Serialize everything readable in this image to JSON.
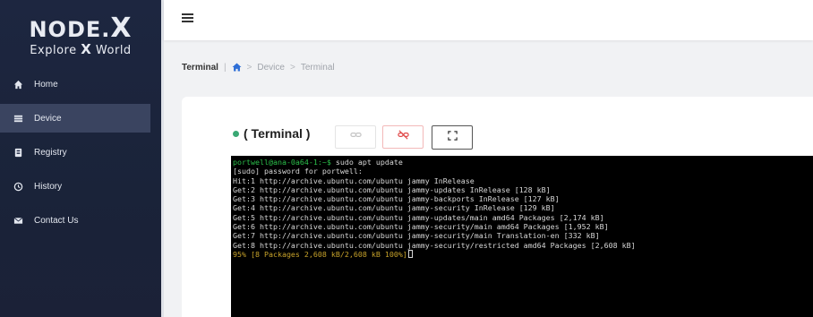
{
  "brand": {
    "title_prefix": "NODE.",
    "title_x": "X",
    "subtitle_a": "Explore ",
    "subtitle_x": "X",
    "subtitle_b": " World"
  },
  "nav": {
    "items": [
      {
        "label": "Home",
        "icon": "home-icon"
      },
      {
        "label": "Device",
        "icon": "device-icon",
        "active": true
      },
      {
        "label": "Registry",
        "icon": "registry-icon"
      },
      {
        "label": "History",
        "icon": "history-icon"
      },
      {
        "label": "Contact Us",
        "icon": "mail-icon"
      }
    ]
  },
  "breadcrumb": {
    "current": "Terminal",
    "divider": "|",
    "sep1": ">",
    "item1": "Device",
    "sep2": ">",
    "item2": "Terminal"
  },
  "terminal_panel": {
    "title": "( Terminal )",
    "status_color": "#3aa874",
    "buttons": [
      {
        "name": "connect",
        "icon": "link-icon"
      },
      {
        "name": "disconnect",
        "icon": "unlink-icon",
        "color": "#e04848"
      },
      {
        "name": "fullscreen",
        "icon": "fullscreen-icon"
      }
    ]
  },
  "terminal": {
    "prompt": "portwell@ana-0a64-1:~$",
    "command": " sudo apt update",
    "lines": [
      "[sudo] password for portwell:",
      "Hit:1 http://archive.ubuntu.com/ubuntu jammy InRelease",
      "Get:2 http://archive.ubuntu.com/ubuntu jammy-updates InRelease [128 kB]",
      "Get:3 http://archive.ubuntu.com/ubuntu jammy-backports InRelease [127 kB]",
      "Get:4 http://archive.ubuntu.com/ubuntu jammy-security InRelease [129 kB]",
      "Get:5 http://archive.ubuntu.com/ubuntu jammy-updates/main amd64 Packages [2,174 kB]",
      "Get:6 http://archive.ubuntu.com/ubuntu jammy-security/main amd64 Packages [1,952 kB]",
      "Get:7 http://archive.ubuntu.com/ubuntu jammy-security/main Translation-en [332 kB]",
      "Get:8 http://archive.ubuntu.com/ubuntu jammy-security/restricted amd64 Packages [2,608 kB]"
    ],
    "progress": "95% [8 Packages 2,608 kB/2,608 kB 100%]"
  }
}
